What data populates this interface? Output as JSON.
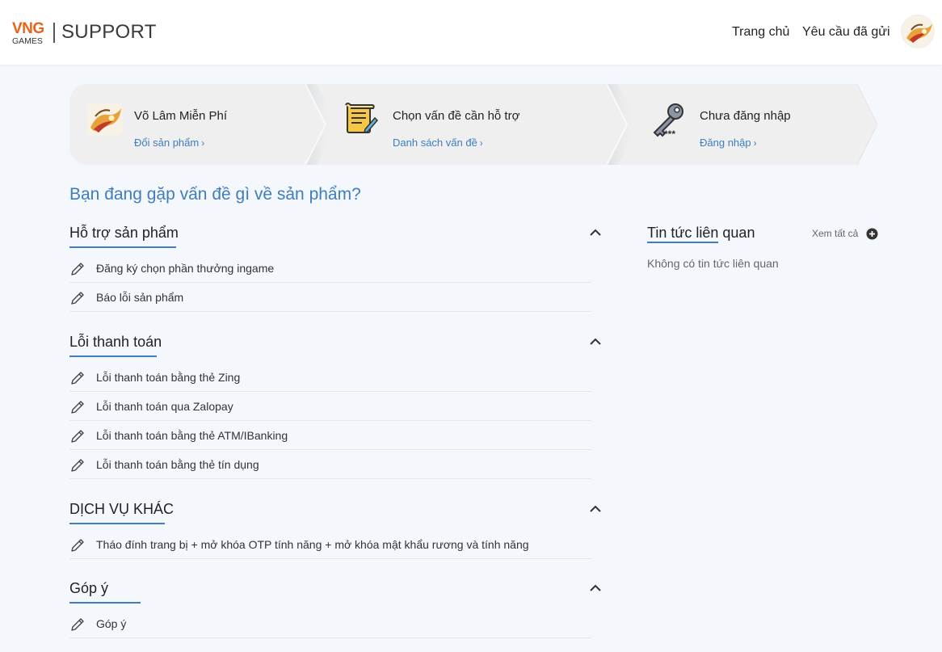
{
  "header": {
    "brand_logo_top": "VNG",
    "brand_logo_bottom": "GAMES",
    "brand_title": "SUPPORT",
    "nav": {
      "home": "Trang chủ",
      "requests": "Yêu cầu đã gửi"
    }
  },
  "steps": [
    {
      "title": "Võ Lâm Miễn Phí",
      "link": "Đổi sản phẩm",
      "icon": "game-logo-icon"
    },
    {
      "title": "Chọn vấn đề cần hỗ trợ",
      "link": "Danh sách vấn đề",
      "icon": "scroll-document-icon"
    },
    {
      "title": "Chưa đăng nhập",
      "link": "Đăng nhập",
      "icon": "key-icon"
    }
  ],
  "main": {
    "heading": "Bạn đang gặp vấn đề gì về sản phẩm?",
    "sections": [
      {
        "title": "Hỗ trợ sản phẩm",
        "items": [
          "Đăng ký chọn phần thưởng ingame",
          "Báo lỗi sản phẩm"
        ]
      },
      {
        "title": "Lỗi thanh toán",
        "items": [
          "Lỗi thanh toán bằng thẻ Zing",
          "Lỗi thanh toán qua Zalopay",
          "Lỗi thanh toán bằng thẻ ATM/IBanking",
          "Lỗi thanh toán bằng thẻ tín dụng"
        ]
      },
      {
        "title": "DỊCH VỤ KHÁC",
        "items": [
          "Tháo đính trang bị + mở khóa OTP tính năng + mở khóa mật khẩu rương và tính năng"
        ]
      },
      {
        "title": "Góp ý",
        "items": [
          "Góp ý"
        ]
      }
    ]
  },
  "sidebar": {
    "title": "Tin tức liên quan",
    "see_all": "Xem tất cả",
    "empty_text": "Không có tin tức liên quan"
  },
  "colors": {
    "accent": "#3e7dc0",
    "brand_orange": "#e8641b",
    "page_bg": "#f4f7fb"
  }
}
